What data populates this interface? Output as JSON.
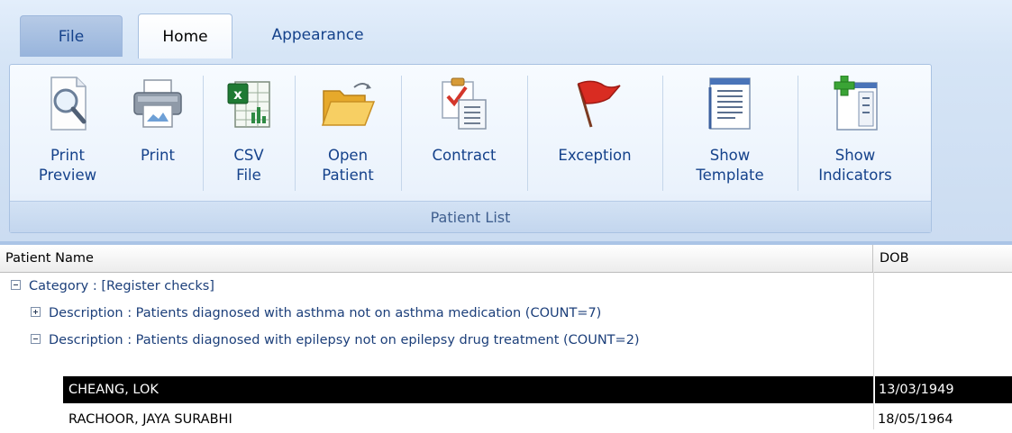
{
  "ribbon": {
    "tabs": {
      "file": "File",
      "home": "Home",
      "appearance": "Appearance"
    },
    "group_label": "Patient List",
    "buttons": {
      "print_preview": {
        "line1": "Print",
        "line2": "Preview",
        "icon": "print-preview-icon"
      },
      "print": {
        "line1": "Print",
        "icon": "printer-icon"
      },
      "csv_file": {
        "line1": "CSV",
        "line2": "File",
        "icon": "excel-csv-icon"
      },
      "open_patient": {
        "line1": "Open",
        "line2": "Patient",
        "icon": "open-folder-icon"
      },
      "contract": {
        "line1": "Contract",
        "icon": "clipboard-checklist-icon"
      },
      "exception": {
        "line1": "Exception",
        "icon": "red-flag-icon"
      },
      "show_template": {
        "line1": "Show",
        "line2": "Template",
        "icon": "template-document-icon"
      },
      "show_indicators": {
        "line1": "Show",
        "line2": "Indicators",
        "icon": "add-indicator-icon"
      }
    }
  },
  "grid": {
    "columns": {
      "name": "Patient Name",
      "dob": "DOB"
    },
    "category": "Category : [Register checks]",
    "descriptions": [
      {
        "text": "Description : Patients diagnosed with asthma not on asthma medication (COUNT=7)",
        "expanded": false
      },
      {
        "text": "Description : Patients diagnosed with epilepsy not on epilepsy drug treatment (COUNT=2)",
        "expanded": true
      }
    ],
    "patients": [
      {
        "name": "CHEANG, LOK",
        "dob": "13/03/1949",
        "selected": true
      },
      {
        "name": "RACHOOR, JAYA SURABHI",
        "dob": "18/05/1964",
        "selected": false
      }
    ]
  }
}
